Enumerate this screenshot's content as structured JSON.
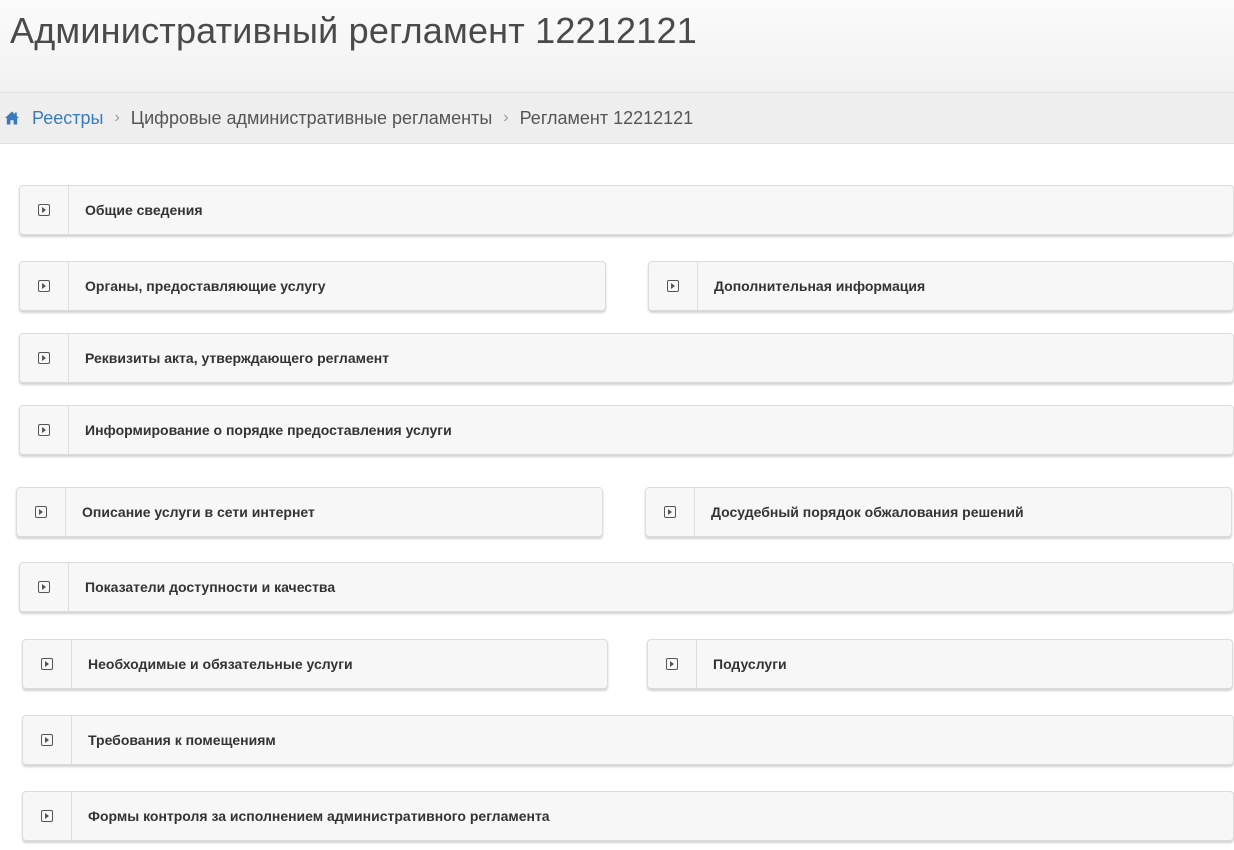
{
  "page": {
    "title": "Административный регламент 12212121"
  },
  "breadcrumb": {
    "home_label": "Реестры",
    "items": [
      "Цифровые административные регламенты",
      "Регламент 12212121"
    ],
    "separator": "›"
  },
  "panels": [
    {
      "label": "Общие сведения"
    },
    {
      "label": "Органы, предоставляющие услугу"
    },
    {
      "label": "Дополнительная информация"
    },
    {
      "label": "Реквизиты акта, утверждающего регламент"
    },
    {
      "label": "Информирование о порядке предоставления услуги"
    },
    {
      "label": "Описание услуги в сети интернет"
    },
    {
      "label": "Досудебный порядок обжалования решений"
    },
    {
      "label": "Показатели доступности и качества"
    },
    {
      "label": "Необходимые и обязательные услуги"
    },
    {
      "label": "Подуслуги"
    },
    {
      "label": "Требования к помещениям"
    },
    {
      "label": "Формы контроля за исполнением административного регламента"
    }
  ],
  "colors": {
    "link": "#3a7bbf",
    "panel_bg": "#f7f7f7",
    "title": "#4a4a4a"
  },
  "icons": {
    "home": "home-icon",
    "panel": "expand-square-icon"
  }
}
